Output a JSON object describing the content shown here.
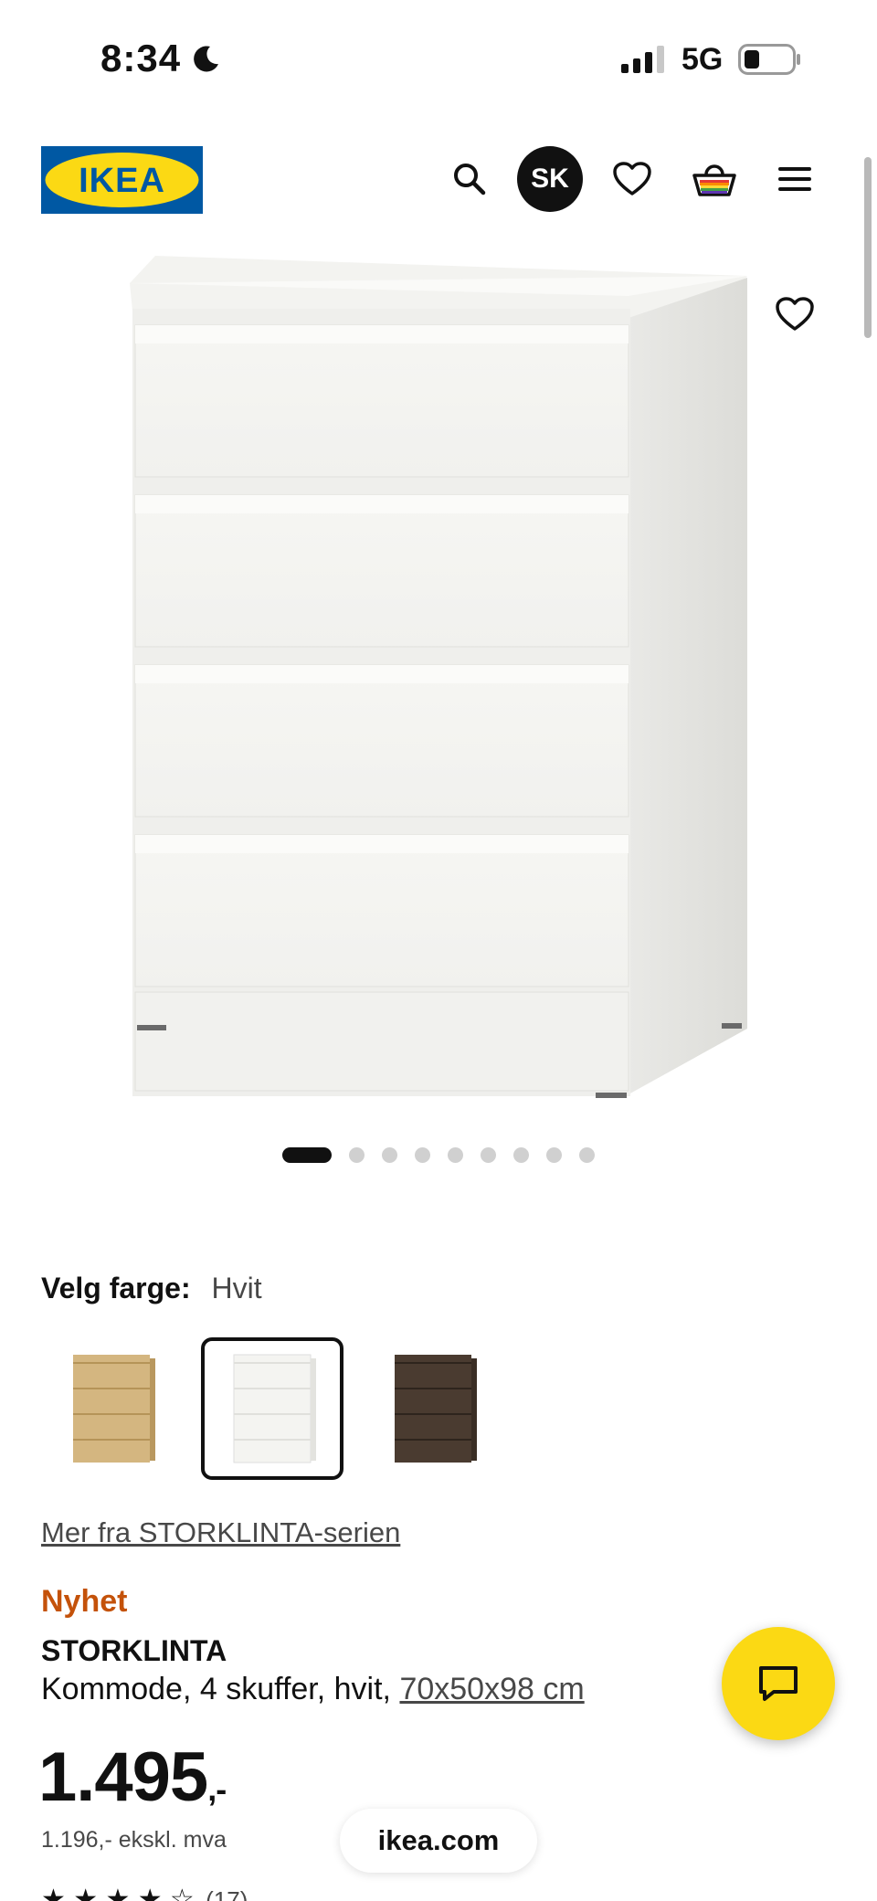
{
  "status_bar": {
    "time": "8:34",
    "network": "5G"
  },
  "header": {
    "logo_text": "IKEA",
    "avatar_initials": "SK",
    "icons": [
      "search-icon",
      "heart-icon",
      "shopping-bag-icon",
      "hamburger-menu-icon"
    ]
  },
  "carousel": {
    "count": 9,
    "active_index": 0
  },
  "color_select": {
    "label": "Velg farge:",
    "value": "Hvit",
    "options": [
      {
        "name": "oak",
        "color": "#cdae79",
        "selected": false
      },
      {
        "name": "white",
        "color": "#f3f3f0",
        "selected": true
      },
      {
        "name": "dark-brown",
        "color": "#4a3b30",
        "selected": false
      }
    ]
  },
  "series_link": "Mer fra STORKLINTA-serien",
  "product": {
    "badge": "Nyhet",
    "name": "STORKLINTA",
    "description": "Kommode, 4 skuffer, hvit,",
    "dimensions": "70x50x98 cm",
    "price": "1.495",
    "price_suffix": ",-",
    "price_ex_vat": "1.196,- ekskl. mva",
    "rating_stars": "★ ★ ★ ★ ☆",
    "rating_count": "(17)"
  },
  "browser": {
    "url": "ikea.com"
  },
  "colors": {
    "ikea_blue": "#0058a3",
    "ikea_yellow": "#fbd914",
    "new_badge": "#c4520a"
  }
}
